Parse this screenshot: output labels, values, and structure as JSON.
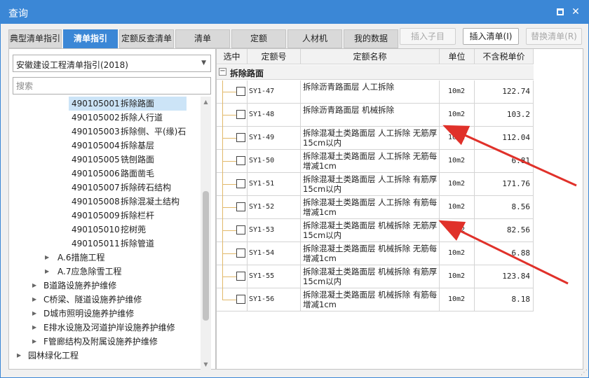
{
  "window": {
    "title": "查询"
  },
  "tabs": [
    "典型清单指引",
    "清单指引",
    "定额反查清单",
    "清单",
    "定额",
    "人材机",
    "我的数据"
  ],
  "buttons": {
    "insert_sub": "插入子目",
    "insert_list": "插入清单(I)",
    "replace_list": "替换清单(R)"
  },
  "filter": {
    "selected": "安徽建设工程清单指引(2018)",
    "search_placeholder": "搜索"
  },
  "tree": [
    {
      "code": "490105001",
      "label": "拆除路面",
      "selected": true
    },
    {
      "code": "490105002",
      "label": "拆除人行道"
    },
    {
      "code": "490105003",
      "label": "拆除侧、平(缘)石"
    },
    {
      "code": "490105004",
      "label": "拆除基层"
    },
    {
      "code": "490105005",
      "label": "铣刨路面"
    },
    {
      "code": "490105006",
      "label": "路面凿毛"
    },
    {
      "code": "490105007",
      "label": "拆除砖石结构"
    },
    {
      "code": "490105008",
      "label": "拆除混凝土结构"
    },
    {
      "code": "490105009",
      "label": "拆除栏杆"
    },
    {
      "code": "490105010",
      "label": "挖树蔸"
    },
    {
      "code": "490105011",
      "label": "拆除管道"
    },
    {
      "code": "",
      "label": "A.6措施工程"
    },
    {
      "code": "",
      "label": "A.7应急除雪工程"
    },
    {
      "code": "",
      "label": "B道路设施养护维修"
    },
    {
      "code": "",
      "label": "C桥梁、隧道设施养护维修"
    },
    {
      "code": "",
      "label": "D城市照明设施养护维修"
    },
    {
      "code": "",
      "label": "E排水设施及河道护岸设施养护维修"
    },
    {
      "code": "",
      "label": "F管廊结构及附属设施养护维修"
    },
    {
      "code": "",
      "label": "园林绿化工程"
    }
  ],
  "grid": {
    "headers": [
      "选中",
      "定额号",
      "定额名称",
      "单位",
      "不含税单价"
    ],
    "group": "拆除路面",
    "rows": [
      {
        "code": "SY1-47",
        "name": "拆除沥青路面层 人工拆除",
        "unit": "10m2",
        "price": "122.74"
      },
      {
        "code": "SY1-48",
        "name": "拆除沥青路面层 机械拆除",
        "unit": "10m2",
        "price": "103.2"
      },
      {
        "code": "SY1-49",
        "name": "拆除混凝土类路面层 人工拆除 无筋厚15cm以内",
        "unit": "10m2",
        "price": "112.04"
      },
      {
        "code": "SY1-50",
        "name": "拆除混凝土类路面层 人工拆除 无筋每增减1cm",
        "unit": "10m2",
        "price": "6.81"
      },
      {
        "code": "SY1-51",
        "name": "拆除混凝土类路面层 人工拆除 有筋厚15cm以内",
        "unit": "10m2",
        "price": "171.76"
      },
      {
        "code": "SY1-52",
        "name": "拆除混凝土类路面层 人工拆除 有筋每增减1cm",
        "unit": "10m2",
        "price": "8.56"
      },
      {
        "code": "SY1-53",
        "name": "拆除混凝土类路面层 机械拆除 无筋厚15cm以内",
        "unit": "10m2",
        "price": "82.56"
      },
      {
        "code": "SY1-54",
        "name": "拆除混凝土类路面层 机械拆除 无筋每增减1cm",
        "unit": "10m2",
        "price": "6.88"
      },
      {
        "code": "SY1-55",
        "name": "拆除混凝土类路面层 机械拆除 有筋厚15cm以内",
        "unit": "10m2",
        "price": "123.84"
      },
      {
        "code": "SY1-56",
        "name": "拆除混凝土类路面层 机械拆除 有筋每增减1cm",
        "unit": "10m2",
        "price": "8.18"
      }
    ]
  },
  "colors": {
    "accent": "#3b87d6",
    "arrow": "#e0312a",
    "selected_row": "#cce4f7"
  }
}
